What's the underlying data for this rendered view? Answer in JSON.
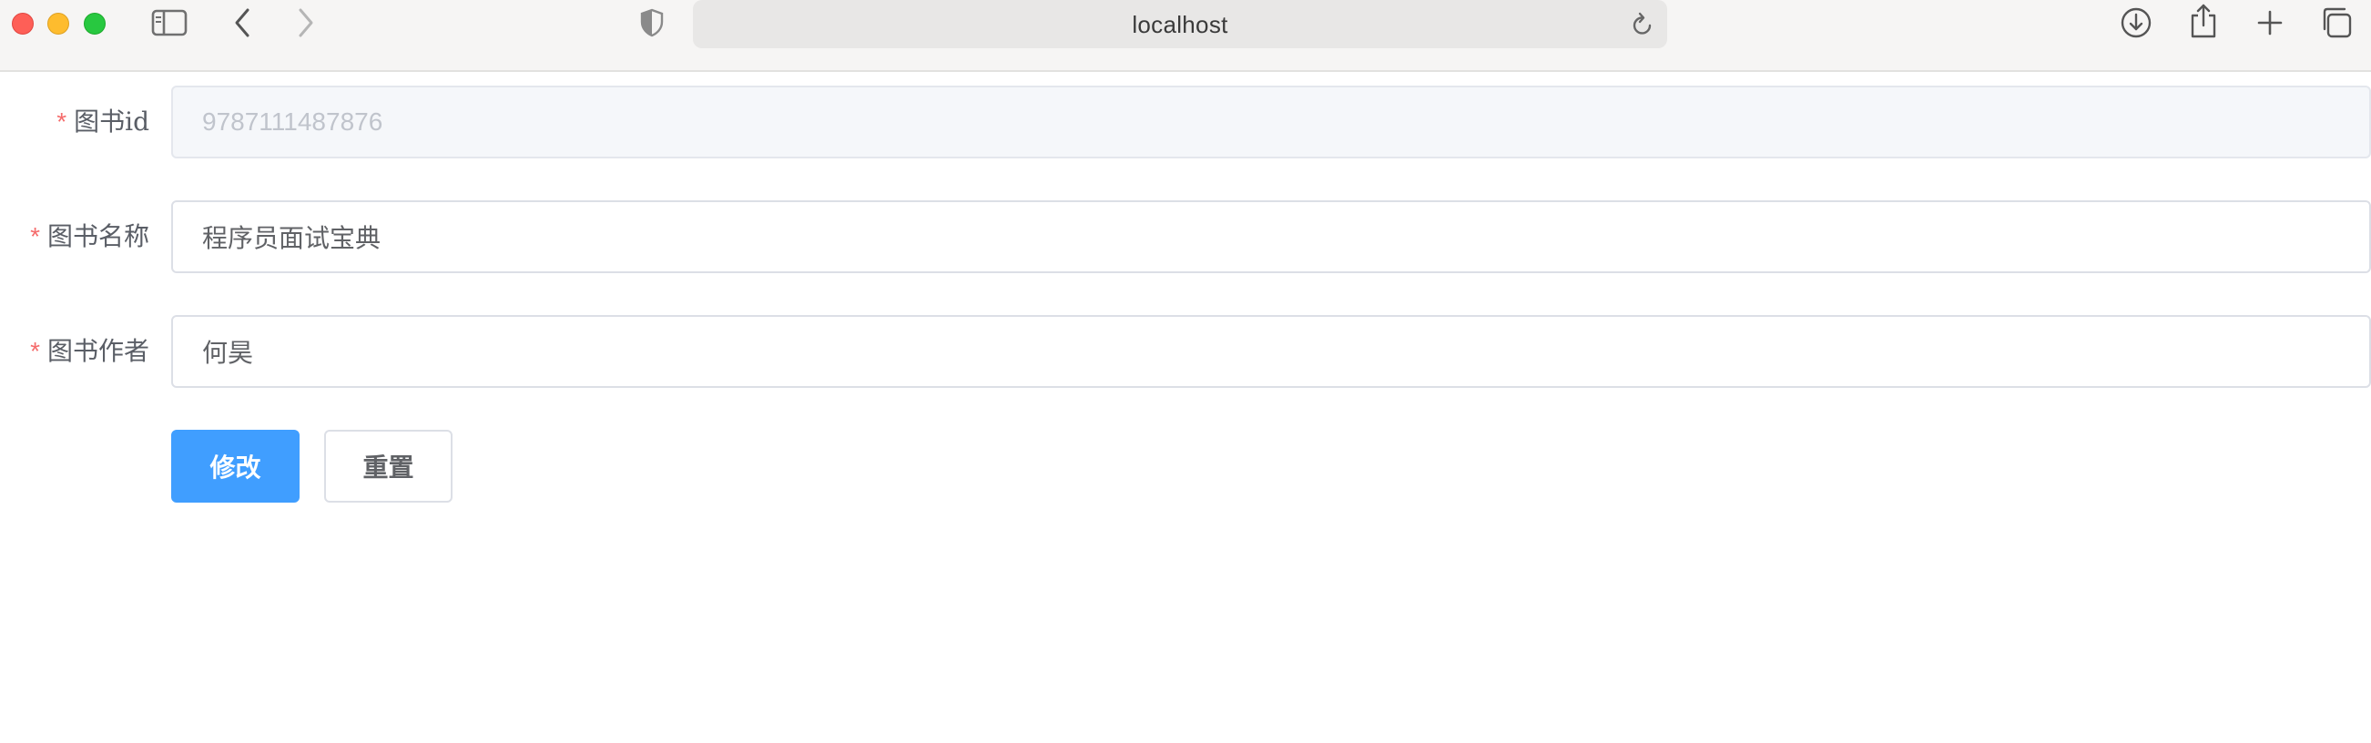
{
  "browser": {
    "url": "localhost",
    "icons": {
      "sidebar": "sidebar-icon",
      "back": "chevron-left-icon",
      "forward": "chevron-right-icon",
      "privacy": "shield-icon",
      "reload": "reload-icon",
      "download": "download-icon",
      "share": "share-icon",
      "new_tab": "plus-icon",
      "tabs": "tabs-overview-icon"
    },
    "colors": {
      "close": "#fe5f57",
      "minimize": "#febc2e",
      "zoom": "#28c840"
    }
  },
  "form": {
    "required_mark": "*",
    "fields": [
      {
        "label": "图书id",
        "value": "9787111487876",
        "disabled": true
      },
      {
        "label": "图书名称",
        "value": "程序员面试宝典",
        "disabled": false
      },
      {
        "label": "图书作者",
        "value": "何昊",
        "disabled": false
      }
    ],
    "buttons": {
      "submit": "修改",
      "reset": "重置"
    },
    "colors": {
      "primary": "#409eff",
      "required": "#f56c6c"
    }
  }
}
